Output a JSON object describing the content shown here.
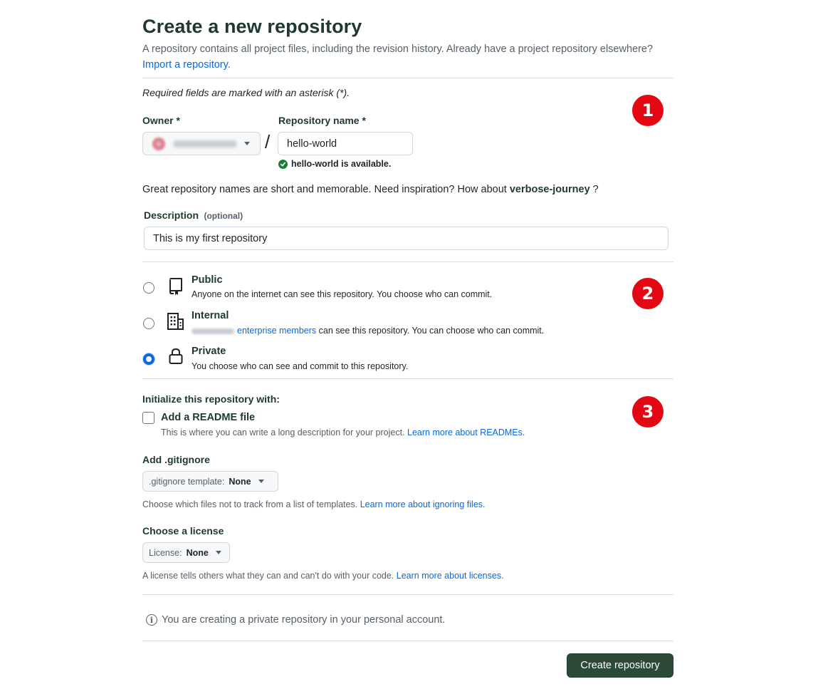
{
  "header": {
    "title": "Create a new repository",
    "intro": "A repository contains all project files, including the revision history. Already have a project repository elsewhere?",
    "import_link": "Import a repository."
  },
  "required_note": "Required fields are marked with an asterisk (*).",
  "owner": {
    "label": "Owner *",
    "value": ""
  },
  "separator": "/",
  "repo_name": {
    "label": "Repository name *",
    "value": "hello-world",
    "availability": "hello-world is available."
  },
  "suggestion": {
    "text": "Great repository names are short and memorable. Need inspiration? How about",
    "name": "verbose-journey",
    "end": " ?"
  },
  "description": {
    "label": "Description",
    "optional": "(optional)",
    "value": "This is my first repository"
  },
  "visibility": {
    "selected": "Private",
    "options": [
      {
        "title": "Public",
        "description": "Anyone on the internet can see this repository. You choose who can commit."
      },
      {
        "title": "Internal",
        "link": "enterprise members",
        "description": " can see this repository. You can choose who can commit."
      },
      {
        "title": "Private",
        "description": "You choose who can see and commit to this repository."
      }
    ]
  },
  "initialize": {
    "heading": "Initialize this repository with:",
    "readme_label": "Add a README file",
    "readme_desc": "This is where you can write a long description for your project.",
    "readme_link": "Learn more about READMEs.",
    "readme_checked": false
  },
  "gitignore": {
    "heading": "Add .gitignore",
    "select_prefix": ".gitignore template:",
    "select_value": "None",
    "desc": "Choose which files not to track from a list of templates.",
    "link": "Learn more about ignoring files."
  },
  "license": {
    "heading": "Choose a license",
    "select_prefix": "License:",
    "select_value": "None",
    "desc": "A license tells others what they can and can't do with your code.",
    "link": "Learn more about licenses."
  },
  "footer_note": "You are creating a private repository in your personal account.",
  "submit_label": "Create repository",
  "badges": [
    "1",
    "2",
    "3"
  ],
  "colors": {
    "primary_button": "#2b4a38",
    "link": "#0969da",
    "badge": "#e30613",
    "success": "#1a7f37"
  }
}
